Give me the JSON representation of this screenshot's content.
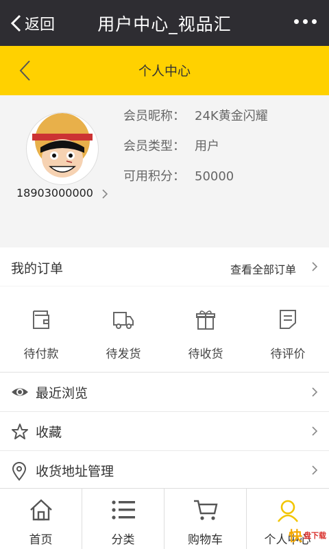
{
  "topbar": {
    "back_label": "返回",
    "title": "用户中心_视品汇"
  },
  "header": {
    "title": "个人中心"
  },
  "profile": {
    "phone": "18903000000",
    "nickname_label": "会员昵称：",
    "nickname": "24K黄金闪耀",
    "type_label": "会员类型：",
    "type": "用户",
    "points_label": "可用积分：",
    "points": "50000"
  },
  "orders": {
    "title": "我的订单",
    "view_all": "查看全部订单",
    "items": [
      {
        "label": "待付款",
        "icon": "wallet-icon"
      },
      {
        "label": "待发货",
        "icon": "truck-icon"
      },
      {
        "label": "待收货",
        "icon": "gift-icon"
      },
      {
        "label": "待评价",
        "icon": "review-icon"
      }
    ]
  },
  "menu": [
    {
      "label": "最近浏览",
      "icon": "eye-icon"
    },
    {
      "label": "收藏",
      "icon": "star-icon"
    },
    {
      "label": "收货地址管理",
      "icon": "location-icon"
    }
  ],
  "tabs": [
    {
      "label": "首页",
      "icon": "home-icon"
    },
    {
      "label": "分类",
      "icon": "list-icon"
    },
    {
      "label": "购物车",
      "icon": "cart-icon"
    },
    {
      "label": "个人中心",
      "icon": "user-icon"
    }
  ],
  "watermark": {
    "logo": "快",
    "text": "盘下载"
  },
  "colors": {
    "topbar": "#2e2d32",
    "accent": "#ffd100",
    "background": "#f4f4f4"
  }
}
